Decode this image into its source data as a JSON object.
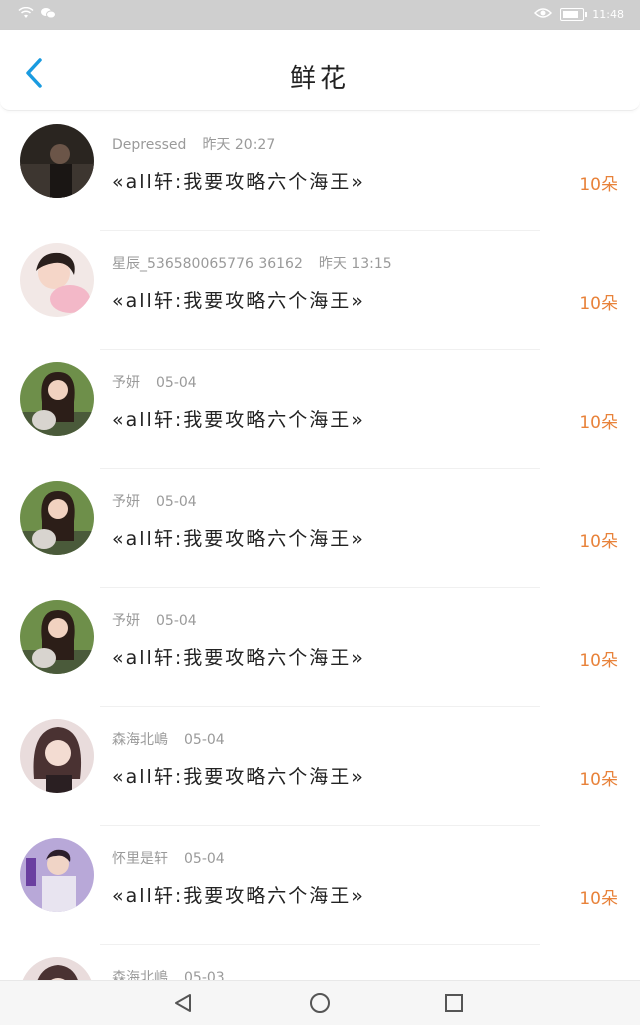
{
  "status_bar": {
    "time": "11:48",
    "icons": [
      "wifi-icon",
      "wechat-icon",
      "eye-icon",
      "battery-icon"
    ],
    "battery_level": 0.85
  },
  "header": {
    "title": "鲜花",
    "back_icon": "back-chevron-icon"
  },
  "colors": {
    "accent": "#1a9be0",
    "count": "#e8823a",
    "status_bar_bg": "#cfcfcf"
  },
  "list": {
    "items": [
      {
        "name": "Depressed",
        "time": "昨天 20:27",
        "book": "«all轩:我要攻略六个海王»",
        "count": "10朵"
      },
      {
        "name": "星辰_536580065776 36162",
        "time": "昨天 13:15",
        "book": "«all轩:我要攻略六个海王»",
        "count": "10朵"
      },
      {
        "name": "予妍",
        "time": "05-04",
        "book": "«all轩:我要攻略六个海王»",
        "count": "10朵"
      },
      {
        "name": "予妍",
        "time": "05-04",
        "book": "«all轩:我要攻略六个海王»",
        "count": "10朵"
      },
      {
        "name": "予妍",
        "time": "05-04",
        "book": "«all轩:我要攻略六个海王»",
        "count": "10朵"
      },
      {
        "name": "森海北嶋",
        "time": "05-04",
        "book": "«all轩:我要攻略六个海王»",
        "count": "10朵"
      },
      {
        "name": "怀里是轩",
        "time": "05-04",
        "book": "«all轩:我要攻略六个海王»",
        "count": "10朵"
      },
      {
        "name": "森海北嶋",
        "time": "05-03",
        "book": "",
        "count": ""
      }
    ]
  },
  "nav_bar": {
    "icons": [
      "back-triangle-icon",
      "home-circle-icon",
      "recents-square-icon"
    ]
  }
}
